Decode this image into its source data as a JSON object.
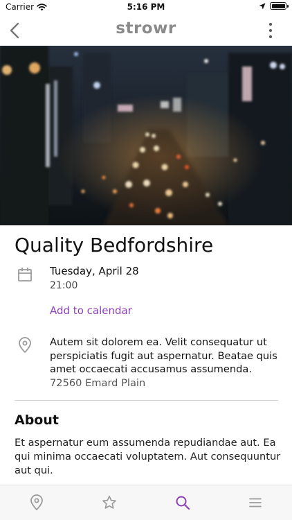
{
  "status": {
    "carrier": "Carrier",
    "time": "5:16 PM"
  },
  "nav": {
    "logo": "strowr",
    "icons": [
      "chevron-left-icon",
      "more-vertical-icon"
    ]
  },
  "event": {
    "title": "Quality Bedfordshire",
    "date": "Tuesday, April 28",
    "time": "21:00",
    "add_to_calendar": "Add to calendar",
    "address": "Autem sit dolorem ea. Velit consequatur ut perspiciatis fugit aut aspernatur. Beatae quis amet occaecati accusamus assumenda.",
    "address_line2": "72560 Emard Plain"
  },
  "about": {
    "heading": "About",
    "body": "Et aspernatur eum assumenda repudiandae aut. Ea qui minima occaecati voluptatem. Aut consequuntur aut qui."
  },
  "tabs": [
    {
      "icon": "location-pin-icon",
      "active": false
    },
    {
      "icon": "star-icon",
      "active": false
    },
    {
      "icon": "search-icon",
      "active": true
    },
    {
      "icon": "menu-icon",
      "active": false
    }
  ],
  "colors": {
    "accent": "#8e3fb8",
    "icon_gray": "#9a9a9a",
    "logo_gray": "#8a8a8a"
  }
}
